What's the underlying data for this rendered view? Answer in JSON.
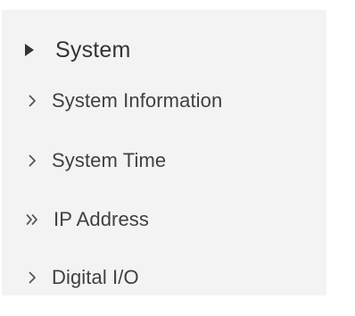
{
  "menu": {
    "section": {
      "label": "System",
      "icon": "caret-right-icon"
    },
    "items": [
      {
        "label": "System Information",
        "icon": "chevron-right-icon"
      },
      {
        "label": "System Time",
        "icon": "chevron-right-icon"
      },
      {
        "label": "IP Address",
        "icon": "double-chevron-right-icon",
        "active": true
      },
      {
        "label": "Digital I/O",
        "icon": "chevron-right-icon"
      }
    ]
  },
  "colors": {
    "panel_background": "#f3f3f3",
    "text": "#404040"
  }
}
